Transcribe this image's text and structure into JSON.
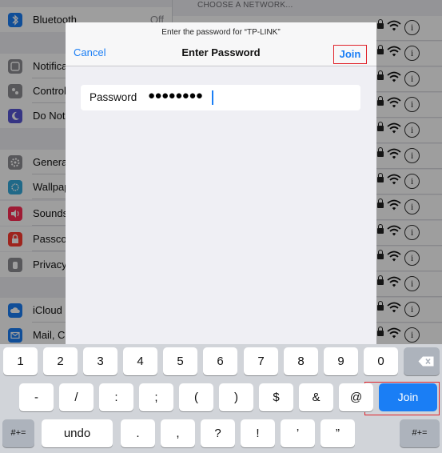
{
  "sidebar": {
    "items": [
      {
        "label": "Bluetooth",
        "value": "Off",
        "icon": "bluetooth-icon",
        "color": "#1a7ef5"
      },
      {
        "label": "Notificat",
        "icon": "notifications-icon",
        "color": "#8e8e93"
      },
      {
        "label": "Control",
        "icon": "control-center-icon",
        "color": "#8e8e93"
      },
      {
        "label": "Do Not",
        "icon": "moon-icon",
        "color": "#5856d6"
      },
      {
        "label": "Genera",
        "icon": "gear-icon",
        "color": "#8e8e93"
      },
      {
        "label": "Wallpap",
        "icon": "wallpaper-icon",
        "color": "#34aadc"
      },
      {
        "label": "Sounds",
        "icon": "speaker-icon",
        "color": "#ff2d55"
      },
      {
        "label": "Passco",
        "icon": "lock-icon",
        "color": "#ff3b30"
      },
      {
        "label": "Privacy",
        "icon": "hand-icon",
        "color": "#8e8e93"
      },
      {
        "label": "iCloud",
        "icon": "cloud-icon",
        "color": "#1a7ef5"
      },
      {
        "label": "Mail, C",
        "icon": "mail-icon",
        "color": "#1a7ef5"
      }
    ]
  },
  "networks": {
    "header": "CHOOSE A NETWORK..."
  },
  "modal": {
    "prompt": "Enter the password for “TP-LINK”",
    "title": "Enter Password",
    "cancel_label": "Cancel",
    "join_label": "Join",
    "password_label": "Password",
    "password_value": "●●●●●●●●"
  },
  "keyboard": {
    "row1": [
      "1",
      "2",
      "3",
      "4",
      "5",
      "6",
      "7",
      "8",
      "9",
      "0"
    ],
    "row2": [
      "-",
      "/",
      ":",
      ";",
      "(",
      ")",
      "$",
      "&",
      "@"
    ],
    "row3": [
      ".",
      ",",
      "?",
      "!",
      "’",
      "”"
    ],
    "shift_label": "#+=",
    "undo_label": "undo",
    "join_label": "Join",
    "delete_icon": "backspace-icon"
  },
  "colors": {
    "accent": "#1a7ef5",
    "highlight": "#e0232b"
  }
}
